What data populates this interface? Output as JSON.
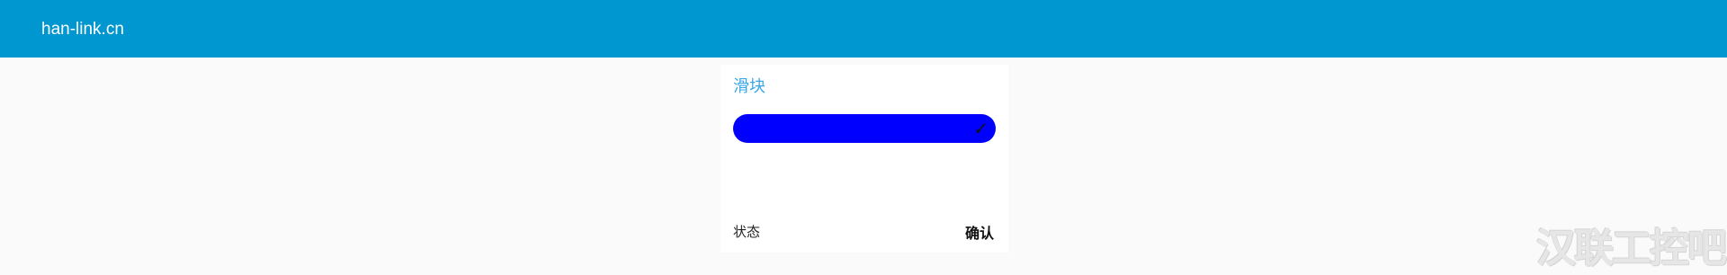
{
  "header": {
    "brand": "han-link.cn",
    "background_color": "#0096d0"
  },
  "card": {
    "title": "滑块",
    "slider": {
      "fill_color": "#0000ff",
      "progress": 1.0,
      "check_symbol": "✓",
      "icon": "check-icon"
    },
    "status_label": "状态",
    "confirm_label": "确认"
  },
  "watermark": {
    "text": "汉联工控吧"
  }
}
